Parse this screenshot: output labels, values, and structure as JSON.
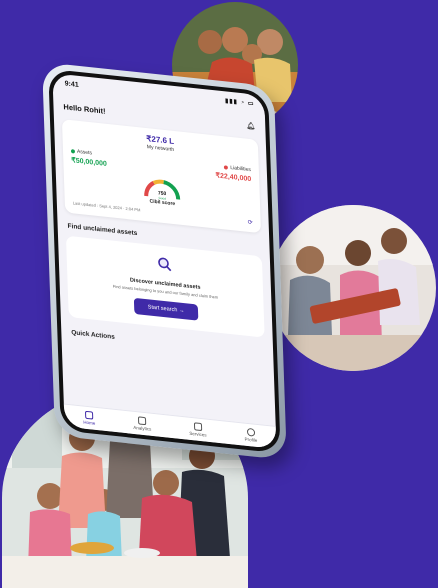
{
  "status_bar": {
    "time": "9:41"
  },
  "header": {
    "greeting": "Hello Rohit!"
  },
  "networth": {
    "value": "₹27.6 L",
    "label": "My networth",
    "assets_label": "Assets",
    "assets_value": "₹50,00,000",
    "liabilities_label": "Liabilities",
    "liabilities_value": "₹22,40,000",
    "cibil_score": "750",
    "cibil_rating": "Good",
    "cibil_label": "Cibil score",
    "last_updated": "Last updated : Sept 4, 2024 · 2:04 PM"
  },
  "unclaimed": {
    "section_title": "Find unclaimed assets",
    "card_title": "Discover unclaimed assets",
    "card_subtitle": "Find assets belonging to you and our family and claim them",
    "button_label": "Start search"
  },
  "quick_actions": {
    "title": "Quick Actions"
  },
  "bottom_nav": [
    {
      "label": "Home",
      "active": true
    },
    {
      "label": "Analytics",
      "active": false
    },
    {
      "label": "Services",
      "active": false
    },
    {
      "label": "Profile",
      "active": false
    }
  ],
  "colors": {
    "background": "#3f2aa8",
    "accent": "#3f2aa8",
    "assets": "#12a150",
    "liabilities": "#e04848"
  }
}
